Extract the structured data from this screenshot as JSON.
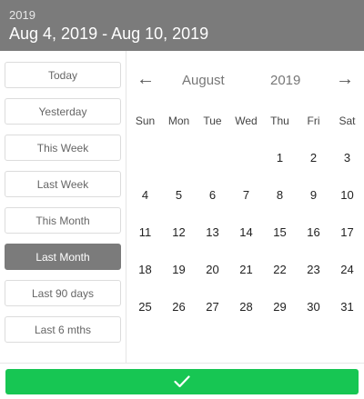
{
  "header": {
    "year": "2019",
    "range": "Aug 4, 2019 - Aug 10, 2019"
  },
  "presets": [
    {
      "label": "Today",
      "active": false
    },
    {
      "label": "Yesterday",
      "active": false
    },
    {
      "label": "This Week",
      "active": false
    },
    {
      "label": "Last Week",
      "active": false
    },
    {
      "label": "This Month",
      "active": false
    },
    {
      "label": "Last Month",
      "active": true
    },
    {
      "label": "Last 90 days",
      "active": false
    },
    {
      "label": "Last 6 mths",
      "active": false
    }
  ],
  "calendar": {
    "prev_icon": "arrow-left-icon",
    "next_icon": "arrow-right-icon",
    "prev_glyph": "←",
    "next_glyph": "→",
    "month": "August",
    "year": "2019",
    "weekdays": [
      "Sun",
      "Mon",
      "Tue",
      "Wed",
      "Thu",
      "Fri",
      "Sat"
    ],
    "weeks": [
      [
        "",
        "",
        "",
        "",
        "1",
        "2",
        "3"
      ],
      [
        "4",
        "5",
        "6",
        "7",
        "8",
        "9",
        "10"
      ],
      [
        "11",
        "12",
        "13",
        "14",
        "15",
        "16",
        "17"
      ],
      [
        "18",
        "19",
        "20",
        "21",
        "22",
        "23",
        "24"
      ],
      [
        "25",
        "26",
        "27",
        "28",
        "29",
        "30",
        "31"
      ]
    ]
  },
  "confirm": {
    "icon": "check-icon",
    "color": "#17c653"
  },
  "colors": {
    "header_bg": "#7b7b7b",
    "active_preset_bg": "#7b7b7b",
    "confirm_bg": "#17c653"
  }
}
